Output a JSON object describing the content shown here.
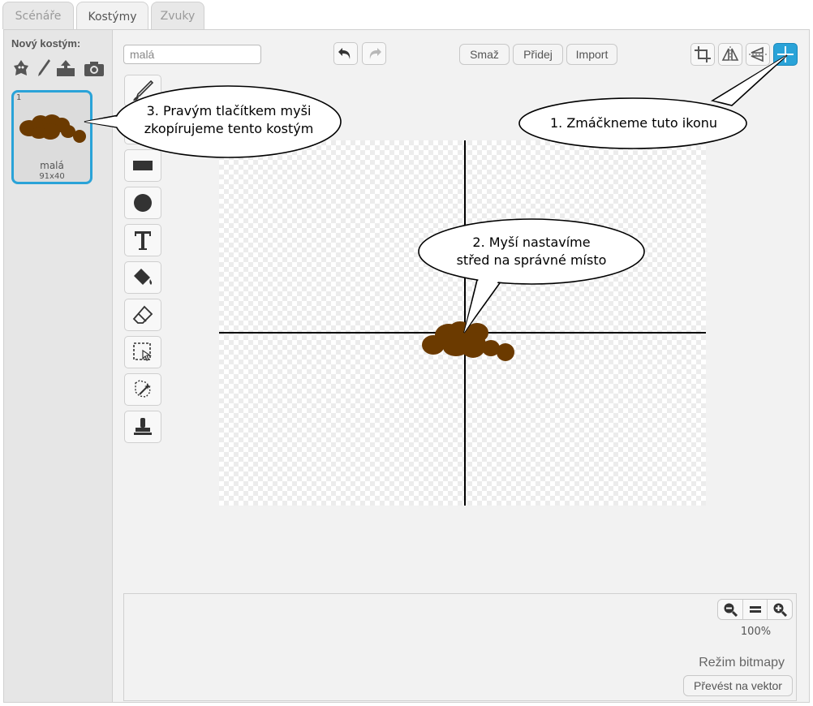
{
  "tabs": [
    {
      "label": "Scénáře",
      "active": false
    },
    {
      "label": "Kostýmy",
      "active": true
    },
    {
      "label": "Zvuky",
      "active": false
    }
  ],
  "sidebar": {
    "new_costume_label": "Nový kostým:",
    "new_costume_icons": [
      "sprite-library-icon",
      "paint-brush-icon",
      "upload-icon",
      "camera-icon"
    ],
    "costumes": [
      {
        "number": "1",
        "name": "malá",
        "size": "91x40",
        "selected": true
      }
    ]
  },
  "editor": {
    "costume_name_value": "malá",
    "toolbar_buttons": [
      "Smaž",
      "Přidej",
      "Import"
    ],
    "right_icons": [
      "crop-icon",
      "flip-horizontal-icon",
      "flip-vertical-icon",
      "set-center-icon"
    ],
    "tools": [
      "brush-icon",
      "line-icon",
      "rectangle-icon",
      "ellipse-icon",
      "text-icon",
      "fill-icon",
      "eraser-icon",
      "select-icon",
      "magic-wand-icon",
      "stamp-icon"
    ],
    "zoom_percent": "100%",
    "mode_label": "Režim bitmapy",
    "convert_button": "Převést na vektor"
  },
  "callouts": {
    "c1": "1. Zmáčkneme tuto ikonu",
    "c2_line1": "2. Myší nastavíme",
    "c2_line2": "střed na správné místo",
    "c3_line1": "3. Pravým tlačítkem myši",
    "c3_line2": "zkopírujeme tento kostým"
  },
  "colors": {
    "accent": "#2aa3d8",
    "costume_fill": "#6b3a00",
    "panel_bg": "#f2f2f2"
  }
}
